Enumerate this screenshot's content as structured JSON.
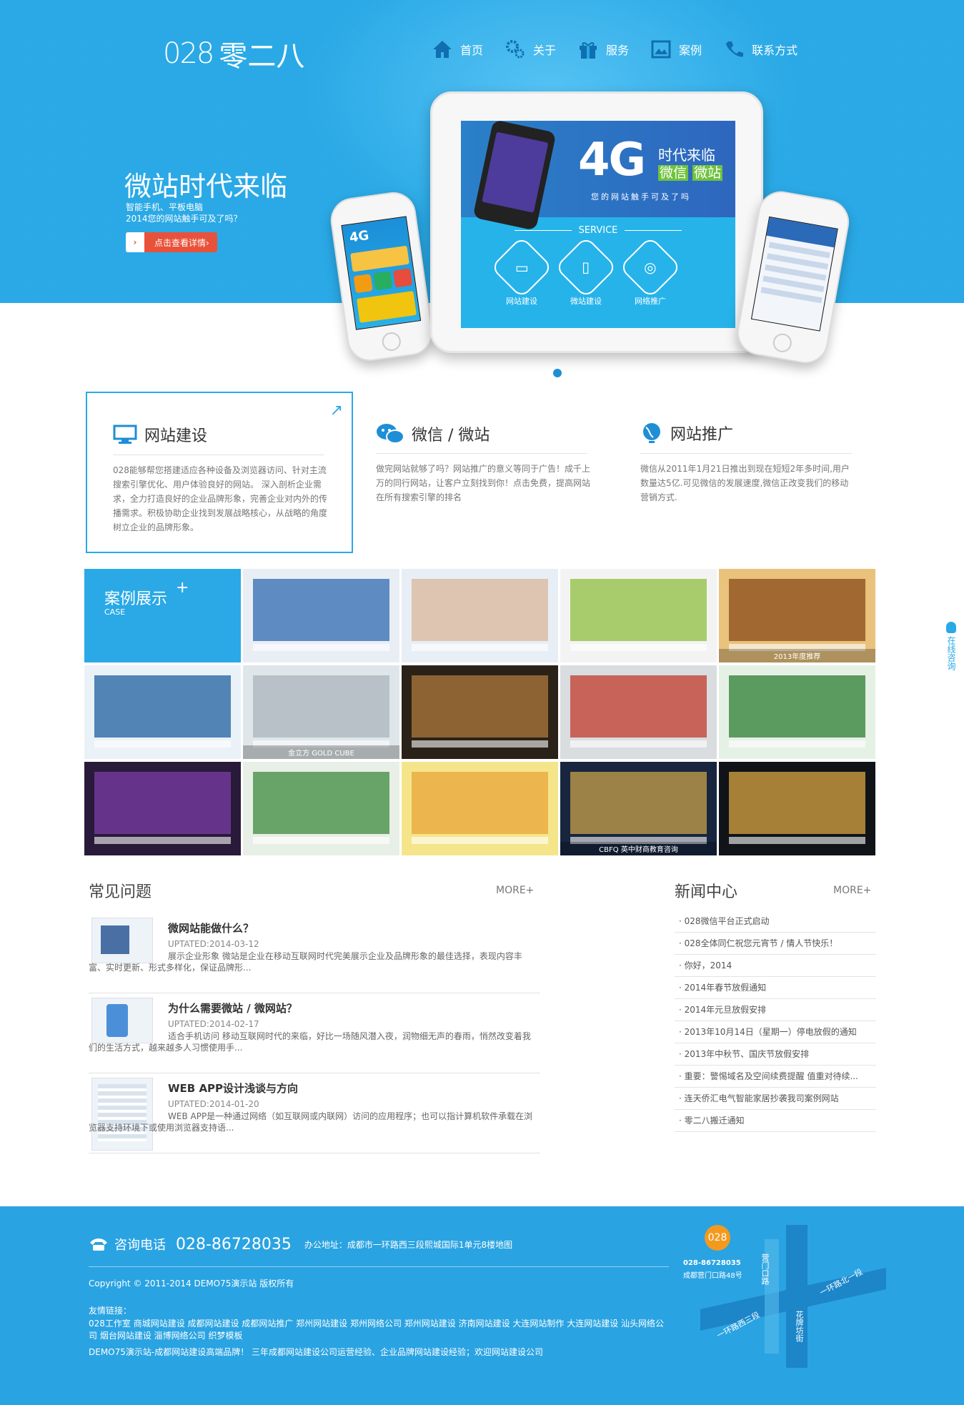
{
  "header": {
    "logo_mark": "028",
    "logo_text": "零二八",
    "nav": [
      {
        "label": "首页",
        "icon": "home-icon"
      },
      {
        "label": "关于",
        "icon": "gears-icon"
      },
      {
        "label": "服务",
        "icon": "gift-icon"
      },
      {
        "label": "案例",
        "icon": "picture-icon"
      },
      {
        "label": "联系方式",
        "icon": "phone-icon"
      }
    ]
  },
  "hero": {
    "title": "微站时代来临",
    "sub1": "智能手机、平板电脑",
    "sub2": "2014您的网站触手可及了吗？",
    "button": "点击查看详情›",
    "tablet_4g": "4G",
    "tablet_line1": "时代来临",
    "tablet_line2a": "微信",
    "tablet_line2b": "微站",
    "tablet_slogan": "您的网站触手可及了吗",
    "service_title": "SERVICE",
    "services": [
      "网站建设",
      "微站建设",
      "网络推广"
    ],
    "small_phone_label": "4G"
  },
  "features": [
    {
      "title": "网站建设",
      "icon": "monitor-icon",
      "text": "028能够帮您搭建适应各种设备及浏览器访问、针对主流搜索引擎优化、用户体验良好的网站。 深入剖析企业需求，全力打造良好的企业品牌形象，完善企业对内外的传播需求。积极协助企业找到发展战略核心，从战略的角度树立企业的品牌形象。"
    },
    {
      "title": "微信 / 微站",
      "icon": "chat-icon",
      "text": "做完网站就够了吗？网站推广的意义等同于广告！成千上万的同行网站，让客户立刻找到你！点击免费，提高网站在所有搜索引擎的排名"
    },
    {
      "title": "网站推广",
      "icon": "globe-icon",
      "text": "微信从2011年1月21日推出到现在短短2年多时间,用户数量达5亿.可见微信的发展速度,微信正改变我们的移动营销方式."
    }
  ],
  "cases": {
    "title": "案例展示",
    "subtitle": "CASE",
    "plus": "+",
    "tiles": [
      {
        "color": "#e9eef5",
        "accent": "#2f6bb0",
        "label": ""
      },
      {
        "color": "#e8eef5",
        "accent": "#d9b79a",
        "label": ""
      },
      {
        "color": "#f3f3f3",
        "accent": "#8fbf3f",
        "label": ""
      },
      {
        "color": "#e9c27c",
        "accent": "#8a4a1a",
        "label": "2013年度推荐"
      },
      {
        "color": "#eaf2f8",
        "accent": "#1f5fa0",
        "label": ""
      },
      {
        "color": "#dfe6ea",
        "accent": "#a9b4bb",
        "label": "金立方 GOLD CUBE"
      },
      {
        "color": "#2a2218",
        "accent": "#b07a3e",
        "label": ""
      },
      {
        "color": "#d9dde0",
        "accent": "#c0392b",
        "label": ""
      },
      {
        "color": "#e6f1e6",
        "accent": "#2e7d32",
        "label": ""
      },
      {
        "color": "#2a1a3a",
        "accent": "#7a3ea6",
        "label": ""
      },
      {
        "color": "#e8efe6",
        "accent": "#3d8b3d",
        "label": ""
      },
      {
        "color": "#f5e58a",
        "accent": "#e8a43a",
        "label": ""
      },
      {
        "color": "#17253f",
        "accent": "#c9a24a",
        "label": "CBFQ 英中财商教育咨询"
      },
      {
        "color": "#101418",
        "accent": "#d8a440",
        "label": ""
      }
    ]
  },
  "faq": {
    "title": "常见问题",
    "more": "MORE+",
    "items": [
      {
        "title": "微网站能做什么？",
        "date": "UPTATED:2014-03-12",
        "desc": "展示企业形象 微站是企业在移动互联网时代完美展示企业及品牌形象的最佳选择，表现内容丰富、实时更新、形式多样化，保证品牌形..."
      },
      {
        "title": "为什么需要微站 / 微网站？",
        "date": "UPTATED:2014-02-17",
        "desc": "适合手机访问 移动互联网时代的来临，好比一场随风潜入夜，润物细无声的春雨，悄然改变着我们的生活方式，越来越多人习惯使用手..."
      },
      {
        "title": "WEB APP设计浅谈与方向",
        "date": "UPTATED:2014-01-20",
        "desc": "WEB APP是一种通过网络（如互联网或内联网）访问的应用程序；也可以指计算机软件承载在浏览器支持环境下或使用浏览器支持语..."
      }
    ]
  },
  "news": {
    "title": "新闻中心",
    "more": "MORE+",
    "items": [
      "· 028微信平台正式启动",
      "· 028全体同仁祝您元宵节 / 情人节快乐！",
      "· 你好，2014",
      "· 2014年春节放假通知",
      "· 2014年元旦放假安排",
      "· 2013年10月14日（星期一）停电放假的通知",
      "· 2013年中秋节、国庆节放假安排",
      "· 重要：警惕域名及空间续费提醒 值重对待续...",
      "· 连天侨汇电气智能家居抄袭我司案例网站",
      "· 零二八搬迁通知"
    ]
  },
  "side_consult": "在线咨询",
  "footer": {
    "tel_label": "咨询电话",
    "tel": "028-86728035",
    "address": "办公地址：成都市一环路西三段熙城国际1单元8楼地图",
    "copyright": "Copyright © 2011-2014 DEMO75演示站 版权所有",
    "links_label": "友情链接：",
    "links": "028工作室 商城网站建设 成都网站建设 成都网站推广 郑州网站建设 郑州网络公司 郑州网站建设 济南网站建设 大连网站制作 大连网站建设 汕头网络公司 烟台网站建设 淄博网络公司 织梦模板",
    "tagline": "DEMO75演示站-成都网站建设高端品牌！ 三年成都网站建设公司运营经验、企业品牌网站建设经验；欢迎网站建设公司",
    "badge": "028",
    "map_tel": "028-86728035",
    "map_addr": "成都营门口路48号",
    "roads": [
      "营门口路",
      "一环路北一段",
      "一环路西三段",
      "花牌坊街"
    ]
  }
}
